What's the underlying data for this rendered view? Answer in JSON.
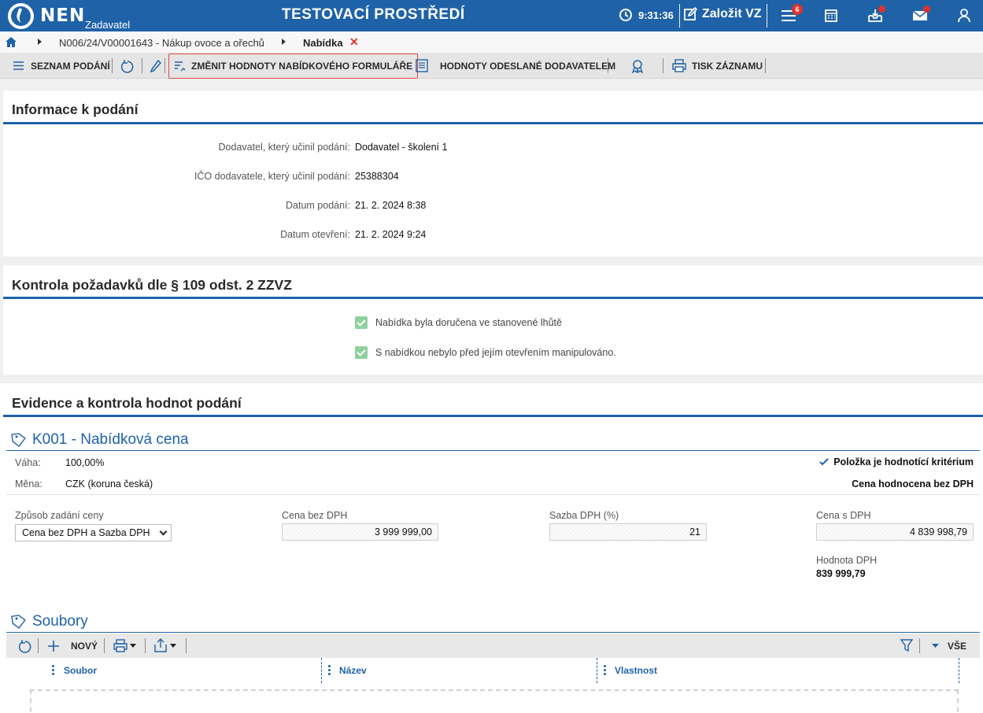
{
  "header": {
    "logo": "NEN",
    "logo_sub": "Zadavatel",
    "env_title": "TESTOVACÍ PROSTŘEDÍ",
    "clock": "9:31:36",
    "new_vz": "Založit VZ",
    "menu_badge": "6",
    "icons": [
      "clock-icon",
      "edit-icon",
      "menu-icon",
      "calculator-icon",
      "inbox-icon",
      "mail-icon",
      "user-icon"
    ]
  },
  "breadcrumb": {
    "item": "N006/24/V00001643 - Nákup ovoce a ořechů",
    "current": "Nabídka",
    "close": "✕"
  },
  "toolbar": {
    "list": "SEZNAM PODÁNÍ",
    "change_values": "ZMĚNIT HODNOTY NABÍDKOVÉHO FORMULÁŘE",
    "sent_values": "HODNOTY ODESLANÉ DODAVATELEM",
    "print": "TISK ZÁZNAMU"
  },
  "info": {
    "title": "Informace k podání",
    "rows": [
      {
        "label": "Dodavatel, který učinil podání:",
        "value": "Dodavatel - školení 1"
      },
      {
        "label": "IČO dodavatele, který učinil podání:",
        "value": "25388304"
      },
      {
        "label": "Datum podání:",
        "value": "21. 2. 2024 8:38"
      },
      {
        "label": "Datum otevření:",
        "value": "21. 2. 2024 9:24"
      }
    ]
  },
  "control": {
    "title": "Kontrola požadavků dle § 109 odst. 2 ZZVZ",
    "checks": [
      "Nabídka byla doručena ve stanovené lhůtě",
      "S nabídkou nebylo před jejím otevřením manipulováno."
    ]
  },
  "evidence": {
    "title": "Evidence a kontrola hodnot podání",
    "criterion": {
      "title": "K001 - Nabídková cena",
      "weight_label": "Váha:",
      "weight_value": "100,00%",
      "currency_label": "Měna:",
      "currency_value": "CZK (koruna česká)",
      "is_criterion": "Položka je hodnotící kritérium",
      "evaluated": "Cena hodnocena bez DPH",
      "price_mode_label": "Způsob zadání ceny",
      "price_mode_value": "Cena bez DPH a Sazba DPH",
      "price_no_vat_label": "Cena bez DPH",
      "price_no_vat_value": "3 999 999,00",
      "vat_rate_label": "Sazba DPH (%)",
      "vat_rate_value": "21",
      "price_vat_label": "Cena s DPH",
      "price_vat_value": "4 839 998,79",
      "vat_amount_label": "Hodnota DPH",
      "vat_amount_value": "839 999,79"
    },
    "files": {
      "title": "Soubory",
      "new_label": "NOVÝ",
      "filter_all": "VŠE",
      "columns": [
        "Soubor",
        "Název",
        "Vlastnost"
      ]
    }
  }
}
